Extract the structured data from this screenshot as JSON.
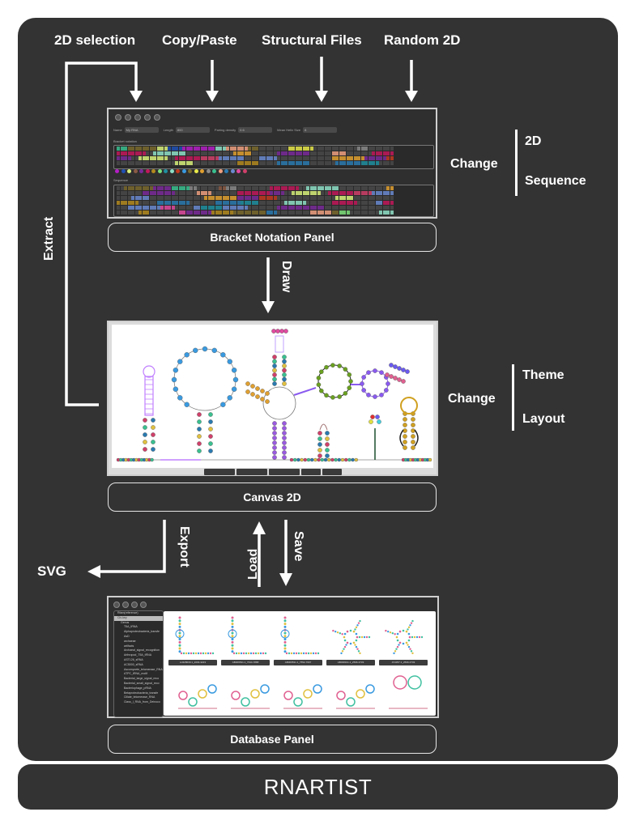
{
  "title": "RNARTIST",
  "inputs_top": [
    "2D selection",
    "Copy/Paste",
    "Structural Files",
    "Random 2D"
  ],
  "panels": {
    "bracket": {
      "caption": "Bracket Notation Panel",
      "fields": [
        {
          "label": "Name",
          "value": "My RNA"
        },
        {
          "label": "Length",
          "value": "800"
        },
        {
          "label": "Pairing density",
          "value": "0.6"
        },
        {
          "label": "Mean Helix Size",
          "value": "8"
        }
      ],
      "bracket_label": "Bracket notation",
      "sequence_label": "Sequence"
    },
    "canvas": {
      "caption": "Canvas 2D"
    },
    "database": {
      "caption": "Database Panel",
      "tree": [
        "Rfam(reference)",
        "Clv-key",
        "Genus",
        "T5A_tRNA",
        "Alphaproteobacteria_transfe",
        "AsD",
        "archaeae",
        "artifacts",
        "Archaeal_signal_recognition",
        "Arthropod_T5A_tRNA",
        "AST126_sRNA",
        "AC5000_sRNA",
        "Ascomycete_telomerase_RNA",
        "ATPC_tRNA_motif",
        "Bacterial_large_signal_reco",
        "Bacterial_small_signal_reco",
        "Bacteriophage_pRNA",
        "Betaproteobacteria_transfe",
        "Ciliate_telomerase_RNA",
        "Class_I_RNA_from_Deinoco"
      ],
      "thumb_captions": [
        "AJ428030.1_2003-3223",
        "AB006531.1_7644-7888",
        "AB006531.1_7552-7607",
        "AB038191.1_2596-3733",
        "JX4357.1_2596-3733"
      ]
    }
  },
  "arrows": {
    "draw": "Draw",
    "extract": "Extract",
    "export": "Export",
    "load": "Load",
    "save": "Save",
    "svg": "SVG"
  },
  "side": {
    "bracket": {
      "verb": "Change",
      "items": [
        "2D",
        "Sequence"
      ]
    },
    "canvas": {
      "verb": "Change",
      "items": [
        "Theme",
        "Layout"
      ]
    }
  },
  "palette": [
    "#b31ec4",
    "#1f4fb3",
    "#d8f07a",
    "#8a5a44",
    "#7a2a9a",
    "#c2185b",
    "#b38a1e",
    "#7ee07a",
    "#1f8fa0",
    "#8fe0c8",
    "#c23a1e",
    "#3a9ae0",
    "#7a6a2e",
    "#e8e84a",
    "#e0a030",
    "#8a8a8a",
    "#3ac090",
    "#f0a080",
    "#2a7ab0",
    "#6a8ad0",
    "#e04aa0",
    "#d0406a"
  ]
}
